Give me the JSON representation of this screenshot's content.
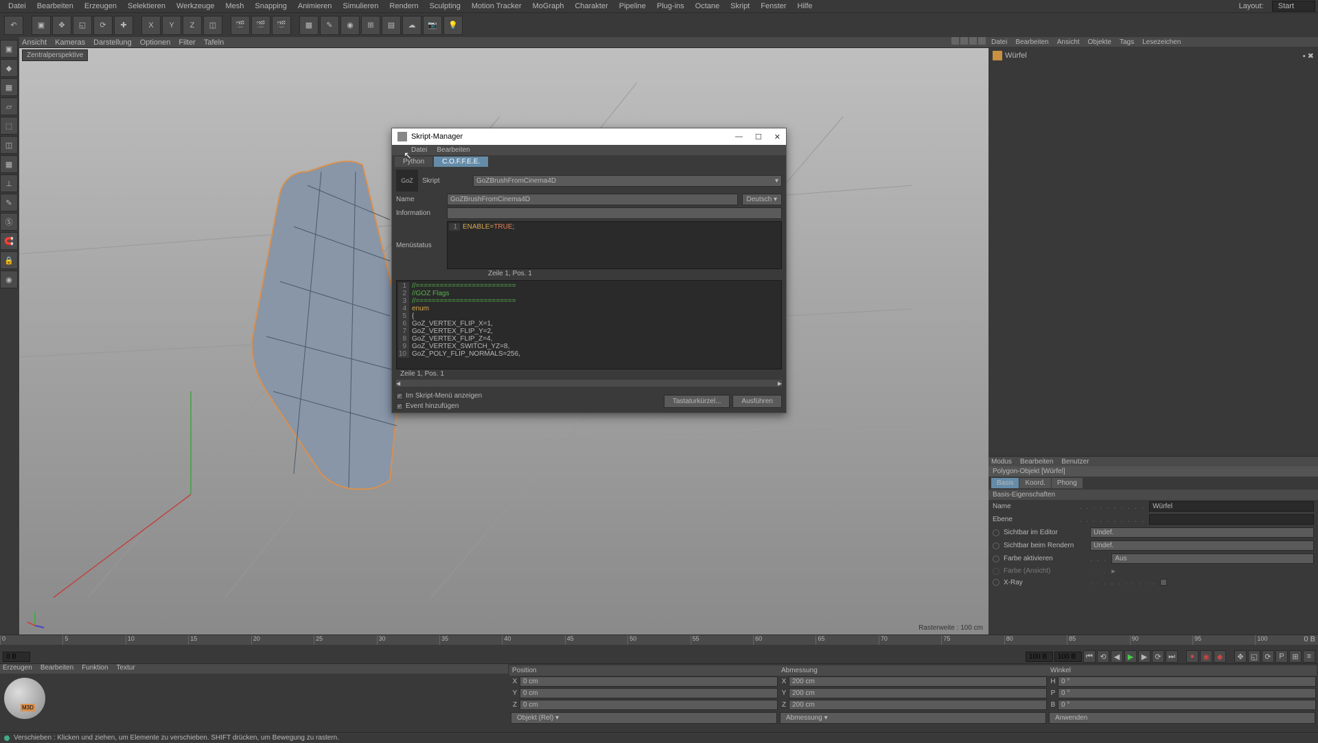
{
  "main_menu": [
    "Datei",
    "Bearbeiten",
    "Erzeugen",
    "Selektieren",
    "Werkzeuge",
    "Mesh",
    "Snapping",
    "Animieren",
    "Simulieren",
    "Rendern",
    "Sculpting",
    "Motion Tracker",
    "MoGraph",
    "Charakter",
    "Pipeline",
    "Plug-ins",
    "Octane",
    "Skript",
    "Fenster",
    "Hilfe"
  ],
  "layout": {
    "label": "Layout:",
    "value": "Start"
  },
  "viewport": {
    "menu": [
      "Ansicht",
      "Kameras",
      "Darstellung",
      "Optionen",
      "Filter",
      "Tafeln"
    ],
    "label": "Zentralperspektive",
    "raster": "Rasterweite : 100 cm"
  },
  "objects_panel": {
    "menu": [
      "Datei",
      "Bearbeiten",
      "Ansicht",
      "Objekte",
      "Tags",
      "Lesezeichen"
    ],
    "item": "Würfel"
  },
  "attr_panel": {
    "menu": [
      "Modus",
      "Bearbeiten",
      "Benutzer"
    ],
    "header": "Polygon-Objekt [Würfel]",
    "tabs": [
      "Basis",
      "Koord.",
      "Phong"
    ],
    "section": "Basis-Eigenschaften",
    "rows": {
      "name_label": "Name",
      "name_value": "Würfel",
      "ebene_label": "Ebene",
      "editor_label": "Sichtbar im Editor",
      "editor_value": "Undef.",
      "render_label": "Sichtbar beim Rendern",
      "render_value": "Undef.",
      "farbe_label": "Farbe aktivieren",
      "farbe_value": "Aus",
      "ansicht_label": "Farbe (Ansicht)",
      "xray_label": "X-Ray"
    }
  },
  "timeline": {
    "ticks": [
      "0",
      "5",
      "10",
      "15",
      "20",
      "25",
      "30",
      "35",
      "40",
      "45",
      "50",
      "55",
      "60",
      "65",
      "70",
      "75",
      "80",
      "85",
      "90",
      "95",
      "100"
    ],
    "extra": "0 B"
  },
  "playback": {
    "start": "0 B",
    "end": "",
    "frame": "100 B",
    "total": "100 B"
  },
  "materials": {
    "menu": [
      "Erzeugen",
      "Bearbeiten",
      "Funktion",
      "Textur"
    ]
  },
  "coords": {
    "headers": [
      "Position",
      "Abmessung",
      "Winkel"
    ],
    "x_pos": "0 cm",
    "x_abm": "200 cm",
    "x_win": "0 °",
    "y_pos": "0 cm",
    "y_abm": "200 cm",
    "y_win": "0 °",
    "z_pos": "0 cm",
    "z_abm": "200 cm",
    "z_win": "0 °",
    "btn1": "Objekt (Rel)",
    "btn2": "Abmessung",
    "btn3": "Anwenden"
  },
  "statusbar": "Verschieben : Klicken und ziehen, um Elemente zu verschieben. SHIFT drücken, um Bewegung zu rastern.",
  "dialog": {
    "title": "Skript-Manager",
    "menu": [
      "Datei",
      "Bearbeiten"
    ],
    "tabs": [
      "Python",
      "C.O.F.F.E.E."
    ],
    "skript_label": "Skript",
    "skript_value": "GoZBrushFromCinema4D",
    "name_label": "Name",
    "name_value": "GoZBrushFromCinema4D",
    "lang": "Deutsch",
    "info_label": "Information",
    "menustatus_label": "Menüstatus",
    "menustatus_code": {
      "ln": "1",
      "txt1": "ENABLE=",
      "txt2": "TRUE",
      ";": ";"
    },
    "menustatus_status": "Zeile 1, Pos. 1",
    "code_lines": [
      {
        "n": "1",
        "type": "sep",
        "txt": "//========================="
      },
      {
        "n": "2",
        "type": "cm",
        "txt": "//GOZ Flags"
      },
      {
        "n": "3",
        "type": "sep",
        "txt": "//========================="
      },
      {
        "n": "4",
        "type": "kw",
        "txt": "enum"
      },
      {
        "n": "5",
        "type": "plain",
        "txt": "{"
      },
      {
        "n": "6",
        "type": "plain",
        "txt": "    GoZ_VERTEX_FLIP_X=1,"
      },
      {
        "n": "7",
        "type": "plain",
        "txt": "    GoZ_VERTEX_FLIP_Y=2,"
      },
      {
        "n": "8",
        "type": "plain",
        "txt": "    GoZ_VERTEX_FLIP_Z=4,"
      },
      {
        "n": "9",
        "type": "plain",
        "txt": "    GoZ_VERTEX_SWITCH_YZ=8,"
      },
      {
        "n": "10",
        "type": "plain",
        "txt": "    GoZ_POLY_FLIP_NORMALS=256,"
      }
    ],
    "code_status": "Zeile 1, Pos. 1",
    "chk1": "Im Skript-Menü anzeigen",
    "chk2": "Event hinzufügen",
    "btn1": "Tastaturkürzel...",
    "btn2": "Ausführen"
  }
}
